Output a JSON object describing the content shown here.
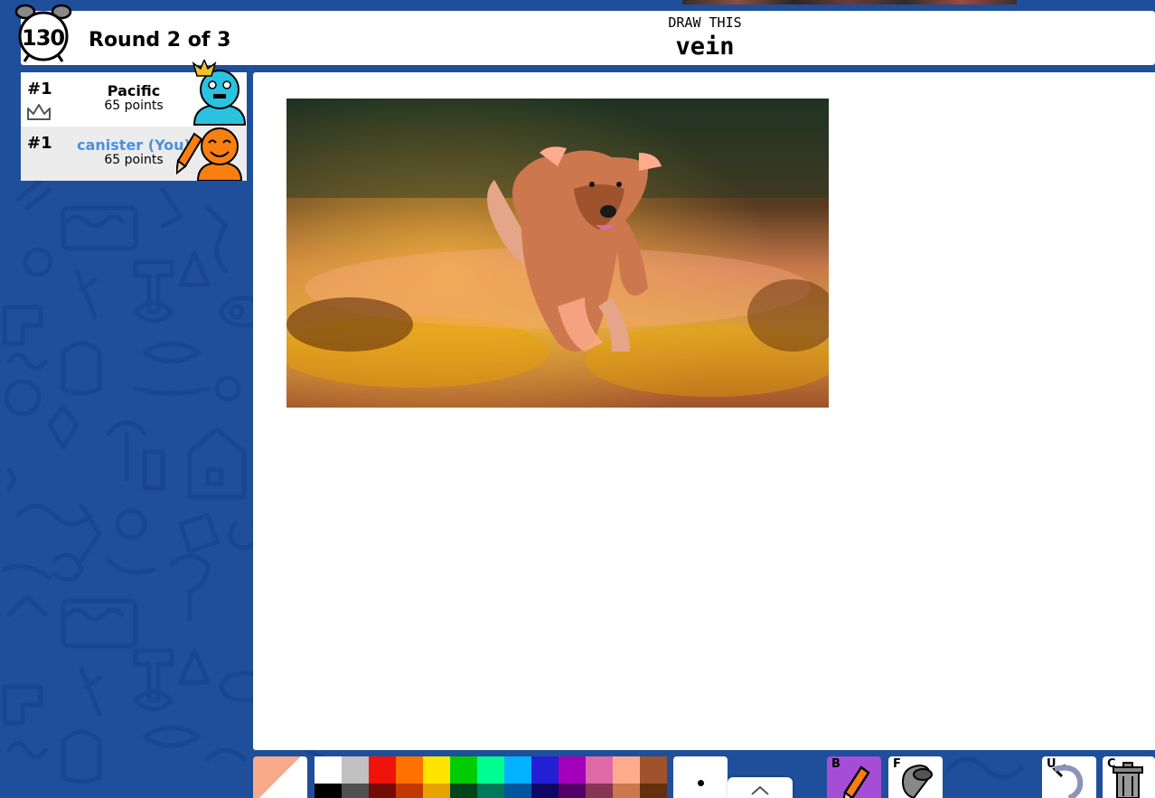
{
  "timer": {
    "seconds": "130"
  },
  "round": {
    "label": "Round 2 of 3"
  },
  "prompt": {
    "label": "DRAW THIS",
    "word": "vein"
  },
  "players": [
    {
      "rank": "#1",
      "name": "Pacific",
      "points": "65 points",
      "is_you": false,
      "avatar_color": "#2bc2e0"
    },
    {
      "rank": "#1",
      "name": "canister (You)",
      "points": "65 points",
      "is_you": true,
      "avatar_color": "#f97f10"
    }
  ],
  "toolbar": {
    "current_color": "#f8a98a",
    "palette_top": [
      "#ffffff",
      "#c1c1c1",
      "#ef130b",
      "#ff7100",
      "#ffe400",
      "#00cc00",
      "#00ff91",
      "#00b2ff",
      "#231fd3",
      "#a300ba",
      "#df69a7",
      "#ffac8e",
      "#a0522d"
    ],
    "palette_bottom": [
      "#000000",
      "#505050",
      "#740b07",
      "#c23800",
      "#e8a200",
      "#004619",
      "#00785d",
      "#00569e",
      "#0e0865",
      "#550069",
      "#873554",
      "#cc774d",
      "#63300d"
    ],
    "tools": [
      {
        "key": "B",
        "name": "brush"
      },
      {
        "key": "F",
        "name": "fill"
      },
      {
        "key": "U",
        "name": "undo"
      },
      {
        "key": "C",
        "name": "clear"
      }
    ]
  }
}
